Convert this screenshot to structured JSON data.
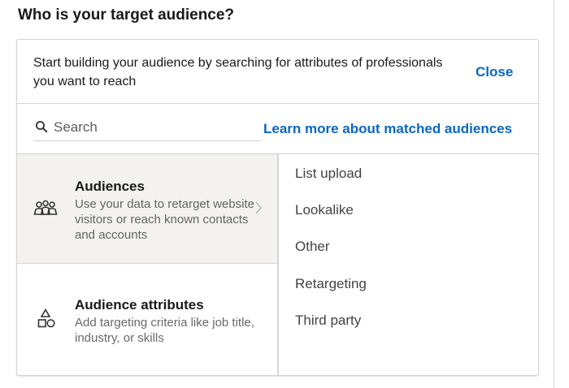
{
  "heading": "Who is your target audience?",
  "intro": {
    "text": "Start building your audience by searching for attributes of professionals you want to reach",
    "close_label": "Close"
  },
  "search": {
    "placeholder": "Search",
    "value": "",
    "learn_more_label": "Learn more about matched audiences"
  },
  "categories": [
    {
      "title": "Audiences",
      "description": "Use your data to retarget website visitors or reach known contacts and accounts",
      "icon": "people-group-icon",
      "selected": true
    },
    {
      "title": "Audience attributes",
      "description": "Add targeting criteria like job title, industry, or skills",
      "icon": "shapes-icon",
      "selected": false
    }
  ],
  "options": [
    "List upload",
    "Lookalike",
    "Other",
    "Retargeting",
    "Third party"
  ],
  "colors": {
    "link": "#0a66c2",
    "selected_bg": "#f3f2ef",
    "border": "#d6d6d6"
  }
}
